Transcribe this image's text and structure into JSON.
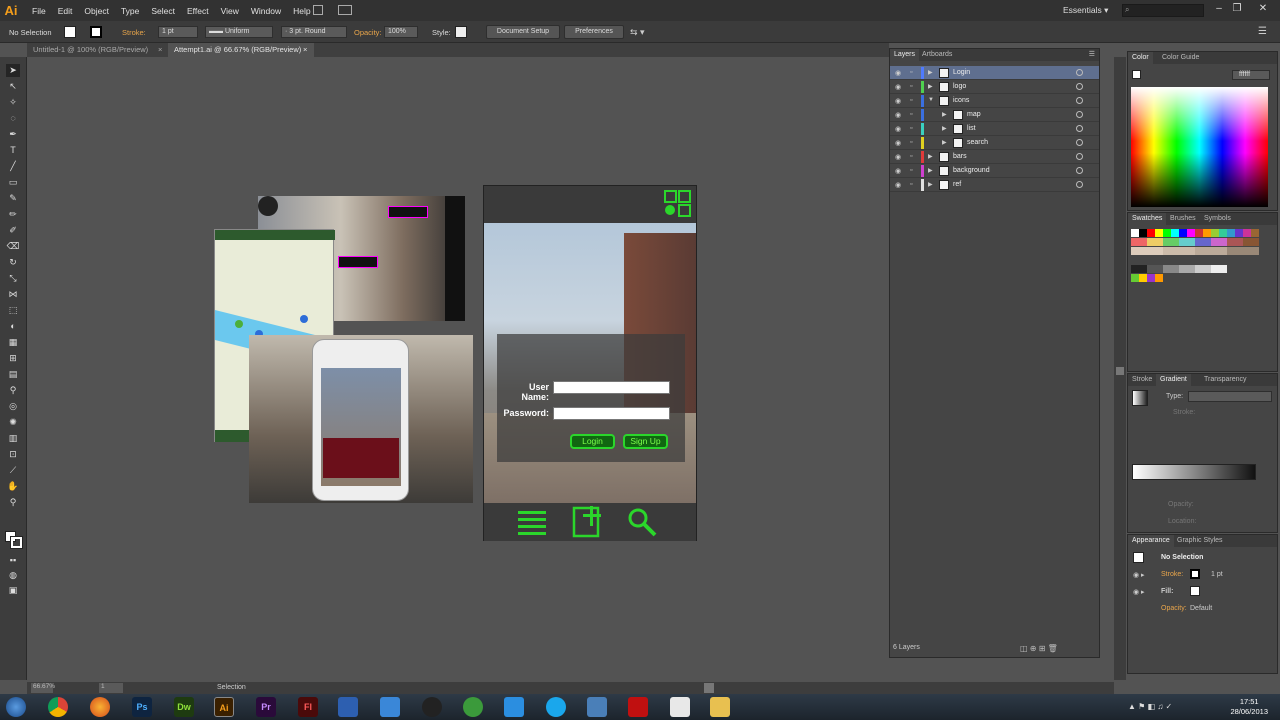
{
  "app": {
    "logo": "Ai"
  },
  "menu": [
    "File",
    "Edit",
    "Object",
    "Type",
    "Select",
    "Effect",
    "View",
    "Window",
    "Help"
  ],
  "workspace": "Essentials",
  "control_bar": {
    "selection": "No Selection",
    "stroke_label": "Stroke:",
    "stroke_weight": "1 pt",
    "profile": "Uniform",
    "brush": "3 pt. Round",
    "opacity_label": "Opacity:",
    "opacity_value": "100%",
    "style_label": "Style:",
    "doc_setup": "Document Setup",
    "preferences": "Preferences"
  },
  "tabs": [
    {
      "label": "Untitled-1 @ 100% (RGB/Preview)",
      "active": false
    },
    {
      "label": "Attempt1.ai @ 66.67% (RGB/Preview)",
      "active": true
    }
  ],
  "layers_panel": {
    "tabs": [
      "Layers",
      "Artboards"
    ],
    "layers": [
      {
        "name": "Login",
        "color": "#4f7bff",
        "depth": 0,
        "expanded": false,
        "selected": true
      },
      {
        "name": "logo",
        "color": "#4fd04f",
        "depth": 0,
        "expanded": false,
        "selected": false
      },
      {
        "name": "icons",
        "color": "#3a6fe0",
        "depth": 0,
        "expanded": true,
        "selected": false
      },
      {
        "name": "map",
        "color": "#3a6fe0",
        "depth": 1,
        "expanded": false,
        "selected": false
      },
      {
        "name": "list",
        "color": "#3ad0c0",
        "depth": 1,
        "expanded": false,
        "selected": false
      },
      {
        "name": "search",
        "color": "#e0d020",
        "depth": 1,
        "expanded": false,
        "selected": false
      },
      {
        "name": "bars",
        "color": "#e03a3a",
        "depth": 0,
        "expanded": false,
        "selected": false
      },
      {
        "name": "background",
        "color": "#d040d0",
        "depth": 0,
        "expanded": false,
        "selected": false
      },
      {
        "name": "ref",
        "color": "#e0e0e0",
        "depth": 0,
        "expanded": false,
        "selected": false
      }
    ],
    "count": "6 Layers"
  },
  "color_panel": {
    "tabs": [
      "Color",
      "Color Guide"
    ],
    "hex": "ffffff"
  },
  "swatches_panel": {
    "tabs": [
      "Swatches",
      "Brushes",
      "Symbols"
    ]
  },
  "gradient_panel": {
    "tabs": [
      "Stroke",
      "Gradient",
      "Transparency"
    ],
    "type_label": "Type:",
    "stroke_label": "Stroke:",
    "opacity_label": "Opacity:",
    "location_label": "Location:"
  },
  "appearance_panel": {
    "tabs": [
      "Appearance",
      "Graphic Styles"
    ],
    "title": "No Selection",
    "stroke_label": "Stroke:",
    "stroke_value": "1 pt",
    "fill_label": "Fill:",
    "opacity_label": "Opacity:",
    "opacity_value": "Default"
  },
  "status_bar": {
    "zoom": "66.67%",
    "page": "1",
    "tool": "Selection"
  },
  "mockup": {
    "username_label": "User Name:",
    "password_label": "Password:",
    "login_button": "Login",
    "signup_button": "Sign Up",
    "accent": "#2bd62b"
  },
  "taskbar": {
    "apps": [
      "start",
      "chrome",
      "firefox",
      "Ps",
      "Dw",
      "Ai",
      "Pr",
      "Fl",
      "word",
      "dropbox",
      "unity",
      "utorrent",
      "twitter",
      "skype",
      "outlook",
      "flash",
      "notepad",
      "explorer"
    ],
    "time": "17:51",
    "date": "28/06/2013"
  }
}
